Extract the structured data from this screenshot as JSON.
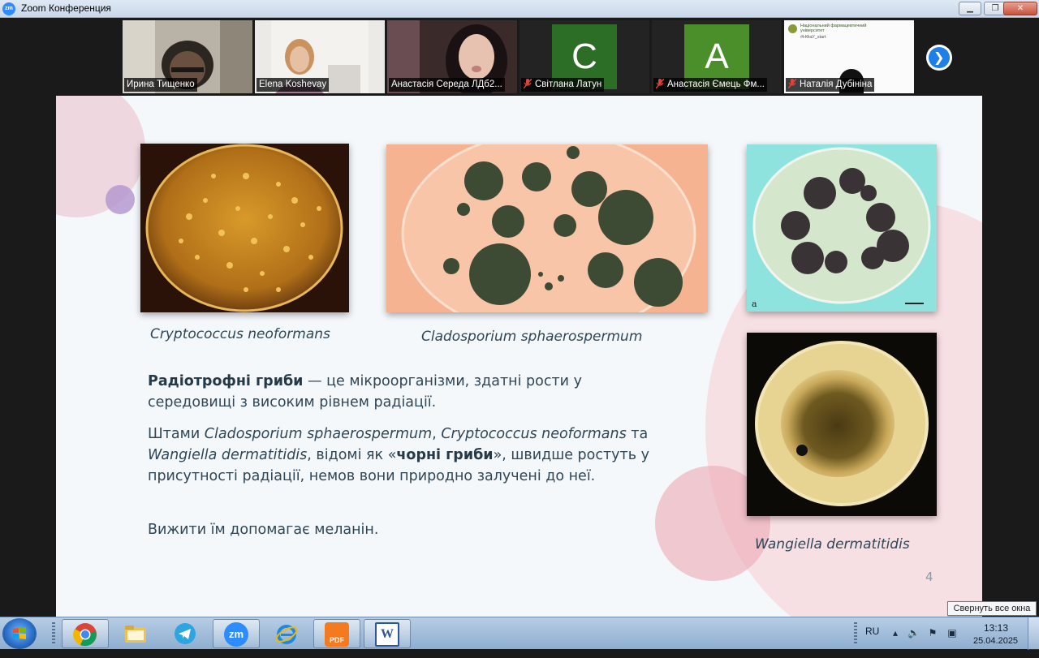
{
  "window": {
    "title": "Zoom Конференция",
    "app_icon": "zm"
  },
  "participants": [
    {
      "name": "Ирина Тищенко",
      "muted": false,
      "video": true,
      "active": true
    },
    {
      "name": "Elena Koshevay",
      "muted": false,
      "video": true,
      "active": false
    },
    {
      "name": "Анастасія Середа ЛДб2...",
      "muted": false,
      "video": true,
      "active": false
    },
    {
      "name": "Світлана Латун",
      "muted": true,
      "video": false,
      "initial": "C",
      "avatar_color": "#2d6e26",
      "active": false
    },
    {
      "name": "Анастасія Ємець Фм...",
      "muted": true,
      "video": false,
      "initial": "A",
      "avatar_color": "#4b8f2a",
      "active": false
    },
    {
      "name": "Наталія Дубініна",
      "muted": true,
      "video": true,
      "screen_text": [
        "Національний фармацевтичний",
        "університет",
        "#НФаУ_start"
      ],
      "active": false
    }
  ],
  "slide": {
    "captions": {
      "c1": "Cryptococcus neoformans",
      "c2": "Cladosporium sphaerospermum",
      "c3": "Wangiella dermatitidis"
    },
    "photo_labels": {
      "p3_letter": "a"
    },
    "p1": {
      "bold": "Радіотрофні гриби",
      "rest": " — це мікроорганізми, здатні рости у середовищі з високим рівнем радіації."
    },
    "p2": {
      "t1": "Штами ",
      "i1": "Cladosporium sphaerospermum",
      "t2": ", ",
      "i2": "Cryptococcus neoformans",
      "t3": " та ",
      "i3": "Wangiella dermatitidis",
      "t4": ", відомі як «",
      "b1": "чорні гриби",
      "t5": "», швидше ростуть у присутності радіації, немов вони природно залучені до неї."
    },
    "p3": "Вижити їм допомагає меланін.",
    "page_number": "4"
  },
  "taskbar": {
    "apps": [
      "chrome-icon",
      "file-explorer-icon",
      "telegram-icon",
      "zoom-icon",
      "internet-explorer-icon",
      "pdf-icon",
      "word-icon"
    ],
    "zoom_label": "zm",
    "pdf_label": "PDF",
    "word_label": "W",
    "lang": "RU",
    "time": "13:13",
    "date": "25.04.2025",
    "tooltip": "Свернуть все окна"
  },
  "colors": {
    "zoom_blue": "#2d8cff",
    "slide_text": "#2f4656",
    "pink_accent": "#e8a3b5",
    "purple_dot": "#b59ad0"
  }
}
